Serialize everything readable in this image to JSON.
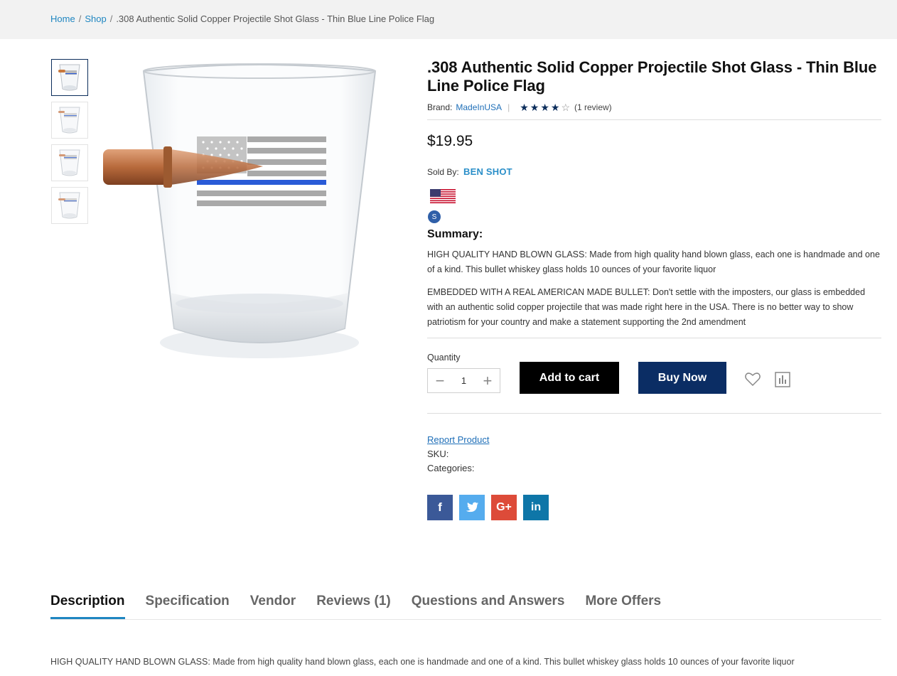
{
  "breadcrumb": {
    "home": "Home",
    "shop": "Shop",
    "current": ".308 Authentic Solid Copper Projectile Shot Glass - Thin Blue Line Police Flag",
    "separator": "/"
  },
  "product": {
    "title": ".308 Authentic Solid Copper Projectile Shot Glass - Thin Blue Line Police Flag",
    "brand_label": "Brand:",
    "brand": "MadeInUSA",
    "rating": 4,
    "rating_max": 5,
    "review_count_text": "(1 review)",
    "price": "$19.95",
    "sold_by_label": "Sold By:",
    "seller": "BEN SHOT",
    "seller_badge": "S"
  },
  "summary": {
    "title": "Summary:",
    "paragraph1": "HIGH QUALITY HAND BLOWN GLASS: Made from high quality hand blown glass, each one is handmade and one of a kind. This bullet whiskey glass holds 10 ounces of your favorite liquor",
    "paragraph2": "EMBEDDED WITH A REAL AMERICAN MADE BULLET: Don't settle with the imposters, our glass is embedded with an authentic solid copper projectile that was made right here in the USA. There is no better way to show patriotism for your country and make a statement supporting the 2nd amendment"
  },
  "purchase": {
    "quantity_label": "Quantity",
    "quantity": "1",
    "minus": "−",
    "plus": "+",
    "add_to_cart": "Add to cart",
    "buy_now": "Buy Now"
  },
  "meta": {
    "report": "Report Product",
    "sku": "SKU:",
    "categories": "Categories:"
  },
  "social": {
    "facebook": "f",
    "twitter": "t",
    "google": "G+",
    "linkedin": "in"
  },
  "tabs": [
    "Description",
    "Specification",
    "Vendor",
    "Reviews (1)",
    "Questions and Answers",
    "More Offers"
  ],
  "description_text": "HIGH QUALITY HAND BLOWN GLASS: Made from high quality hand blown glass, each one is handmade and one of a kind. This bullet whiskey glass holds 10 ounces of your favorite liquor",
  "icons": {
    "wishlist": "heart-icon",
    "compare": "compare-icon",
    "star": "star-icon"
  },
  "colors": {
    "link": "#1f86c1",
    "navy": "#0b2d64",
    "thin_blue_line": "#2a5bd7"
  }
}
